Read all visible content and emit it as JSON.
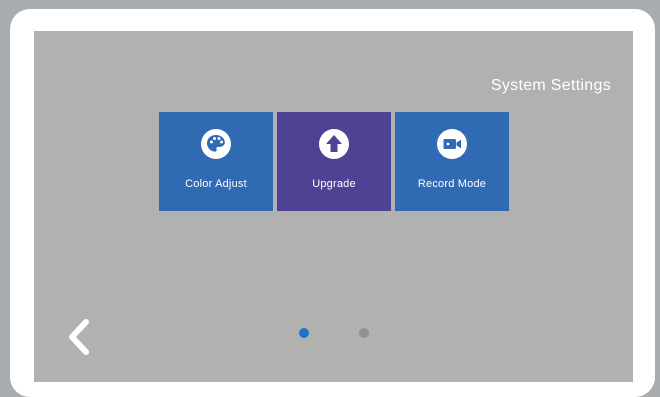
{
  "header": {
    "title": "System Settings"
  },
  "tiles": [
    {
      "label": "Color Adjust",
      "icon": "palette-icon",
      "color": "#2f6ab3"
    },
    {
      "label": "Upgrade",
      "icon": "upload-arrow-icon",
      "color": "#4f4295",
      "state": "selected"
    },
    {
      "label": "Record Mode",
      "icon": "video-camera-icon",
      "color": "#2f6ab3"
    }
  ],
  "navigation": {
    "back_icon": "chevron-left-icon",
    "page_indicator": {
      "current": 1,
      "total": 2
    }
  },
  "colors": {
    "screen_background": "#b1b2b0",
    "bezel": "#ffffff",
    "tile_blue": "#2f6ab3",
    "tile_selected": "#4f4295",
    "dot_active": "#1d73c9",
    "dot_inactive": "#8f9192"
  }
}
